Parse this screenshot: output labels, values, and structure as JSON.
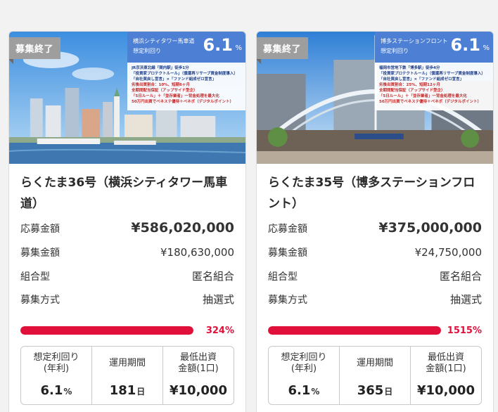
{
  "cards": [
    {
      "badge": "募集終了",
      "overlay": {
        "name": "横浜シティタワー馬車道",
        "subtitle": "想定利回り",
        "rate": "6.1",
        "rate_unit": "%",
        "lines": [
          "JR京浜東北線「関内駅」徒歩1分",
          "「投資家プロテクトルール」（僕還再リサーブ資金制度導入）",
          "「自社買戻し宣言」×「ファンド組成ゼロ宣言」",
          "劣後出資割合：10%、短期6ヶ月",
          "全期間配当保証（アップサイド型企）",
          "「5日ルール」＋「並存業者」一背金処理を最大化",
          "50万円出資でベネステ優待＋ベネボ（デジタルポイント）"
        ]
      },
      "title": "らくたま36号（横浜シティタワー馬車道）",
      "rows": [
        {
          "label": "応募金額",
          "value": "¥586,020,000"
        },
        {
          "label": "募集金額",
          "value": "¥180,630,000"
        },
        {
          "label": "組合型",
          "value": "匿名組合"
        },
        {
          "label": "募集方式",
          "value": "抽選式"
        }
      ],
      "progress": 324,
      "progress_text": "324%",
      "stats": [
        {
          "label1": "想定利回り",
          "label2": "(年利)",
          "value": "6.1",
          "unit": "%"
        },
        {
          "label1": "運用期間",
          "label2": "",
          "value": "181",
          "unit": "日"
        },
        {
          "label1": "最低出資",
          "label2": "金額(1口)",
          "value": "¥10,000",
          "unit": ""
        }
      ]
    },
    {
      "badge": "募集終了",
      "overlay": {
        "name": "博多ステーションフロント",
        "subtitle": "想定利回り",
        "rate": "6.1",
        "rate_unit": "%",
        "lines": [
          "福岡市営地下鉄「博多駅」徒歩4分",
          "「投資家プロテクトルール」（僕還再リサーブ資金制度導入）",
          "「自社買戻し宣言」×「ファンド組成ゼロ宣言」",
          "劣後出資割合：25%、短期12ヶ月",
          "全期間配当保証（アップサイド型企）",
          "「5日ルール」＋「並存業者」一背金処理を最大化",
          "50万円出資でベネステ優待＋ベネボ（デジタルポイント）"
        ]
      },
      "title": "らくたま35号（博多ステーションフロント）",
      "rows": [
        {
          "label": "応募金額",
          "value": "¥375,000,000"
        },
        {
          "label": "募集金額",
          "value": "¥24,750,000"
        },
        {
          "label": "組合型",
          "value": "匿名組合"
        },
        {
          "label": "募集方式",
          "value": "抽選式"
        }
      ],
      "progress": 1515,
      "progress_text": "1515%",
      "stats": [
        {
          "label1": "想定利回り",
          "label2": "(年利)",
          "value": "6.1",
          "unit": "%"
        },
        {
          "label1": "運用期間",
          "label2": "",
          "value": "365",
          "unit": "日"
        },
        {
          "label1": "最低出資",
          "label2": "金額(1口)",
          "value": "¥10,000",
          "unit": ""
        }
      ]
    }
  ]
}
